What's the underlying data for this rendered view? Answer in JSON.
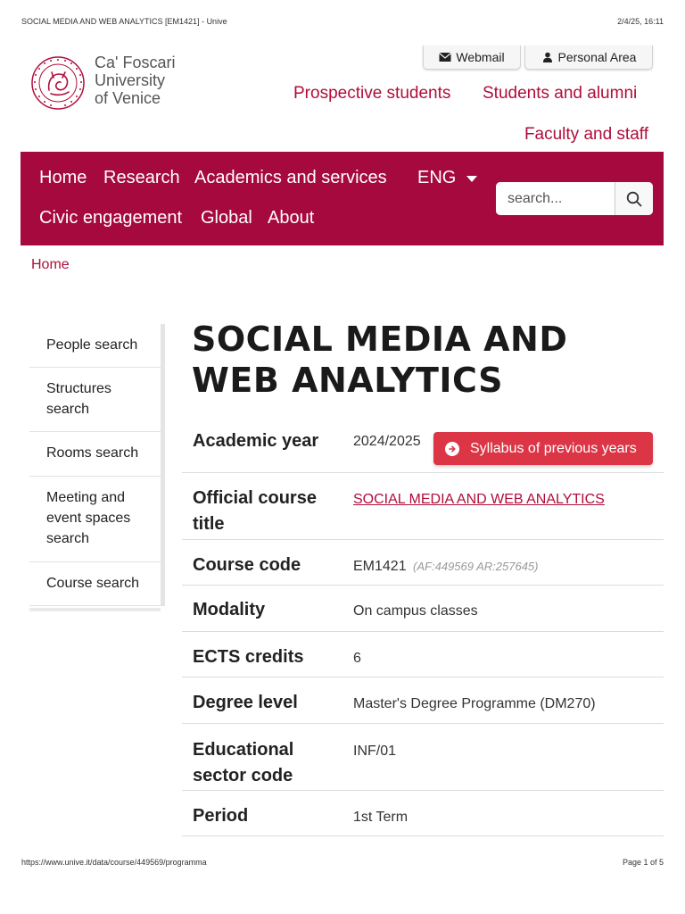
{
  "print": {
    "title": "SOCIAL MEDIA AND WEB ANALYTICS [EM1421] - Unive",
    "datetime": "2/4/25, 16:11",
    "url": "https://www.unive.it/data/course/449569/programma",
    "page": "Page 1 of 5"
  },
  "brand": {
    "line1": "Ca' Foscari",
    "line2": "University",
    "line3": "of Venice",
    "accent": "#a6093d",
    "link_color": "#b00d3a"
  },
  "utility": {
    "webmail": "Webmail",
    "personal_area": "Personal Area"
  },
  "audience": {
    "prospective": "Prospective students",
    "students": "Students and alumni",
    "faculty": "Faculty and staff"
  },
  "nav": {
    "home": "Home",
    "research": "Research",
    "academics": "Academics and services",
    "language": "ENG",
    "civic": "Civic engagement",
    "global": "Global",
    "about": "About"
  },
  "search": {
    "placeholder": "search..."
  },
  "breadcrumb": {
    "home": "Home"
  },
  "sidebar": {
    "items": [
      {
        "label": "People search"
      },
      {
        "label": "Structures search"
      },
      {
        "label": "Rooms search"
      },
      {
        "label": "Meeting and event spaces search"
      },
      {
        "label": "Course search"
      }
    ]
  },
  "course": {
    "title": "SOCIAL MEDIA AND WEB ANALYTICS",
    "syllabus_button": "Syllabus of previous years",
    "fields": {
      "academic_year": {
        "label": "Academic year",
        "value": "2024/2025"
      },
      "official_title": {
        "label": "Official course title",
        "value": "SOCIAL MEDIA AND WEB ANALYTICS"
      },
      "course_code": {
        "label": "Course code",
        "value": "EM1421",
        "extra": "(AF:449569 AR:257645)"
      },
      "modality": {
        "label": "Modality",
        "value": "On campus classes"
      },
      "ects": {
        "label": "ECTS credits",
        "value": "6"
      },
      "degree_level": {
        "label": "Degree level",
        "value": "Master's Degree Programme (DM270)"
      },
      "sector_code": {
        "label": "Educational sector code",
        "value": "INF/01"
      },
      "period": {
        "label": "Period",
        "value": "1st Term"
      }
    }
  }
}
